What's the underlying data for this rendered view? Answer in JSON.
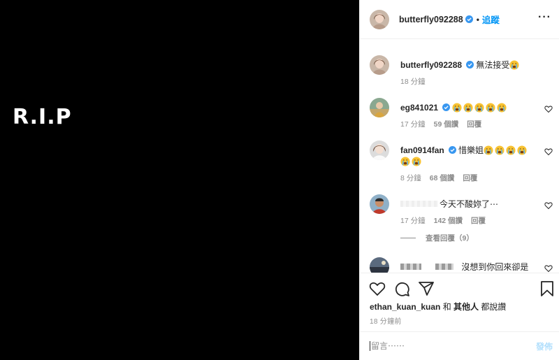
{
  "media": {
    "text": "R.I.P"
  },
  "header": {
    "username": "butterfly092288",
    "separator": "•",
    "follow_label": "追蹤",
    "more_label": "···"
  },
  "comments": [
    {
      "username": "butterfly092288",
      "text": "無法接受",
      "emoji_count": 1,
      "time": "18 分鐘",
      "likes": "",
      "reply": "",
      "verified": true
    },
    {
      "username": "eg841021",
      "text": "",
      "emoji_count": 5,
      "time": "17 分鐘",
      "likes": "59 個讚",
      "reply": "回覆",
      "verified": true
    },
    {
      "username": "fan0914fan",
      "text": "惜樂姐",
      "emoji_count": 6,
      "time": "8 分鐘",
      "likes": "68 個讚",
      "reply": "回覆",
      "verified": true
    },
    {
      "username": "",
      "text": "今天不酸妳了⋯",
      "emoji_count": 0,
      "time": "17 分鐘",
      "likes": "142 個讚",
      "reply": "回覆",
      "verified": false
    },
    {
      "username": "",
      "text": "沒想到你回來卻是",
      "emoji_count": 0,
      "time": "",
      "likes": "",
      "reply": "",
      "verified": false
    }
  ],
  "view_replies_label": "查看回覆（9）",
  "likes_line": {
    "user": "ethan_kuan_kuan",
    "connector": " 和 ",
    "others": "其他人",
    "suffix": " 都說讚"
  },
  "timestamp": "18 分鐘前",
  "add_comment": {
    "placeholder": "留言⋯⋯",
    "post_label": "發佈"
  },
  "colors": {
    "accent": "#0095f6",
    "verified": "#3897f0",
    "muted": "#8e8e8e",
    "post_disabled": "#b2dffc"
  },
  "icons": [
    "heart-icon",
    "comment-icon",
    "share-icon",
    "bookmark-icon",
    "verified-badge-icon",
    "crying-face-emoji"
  ]
}
